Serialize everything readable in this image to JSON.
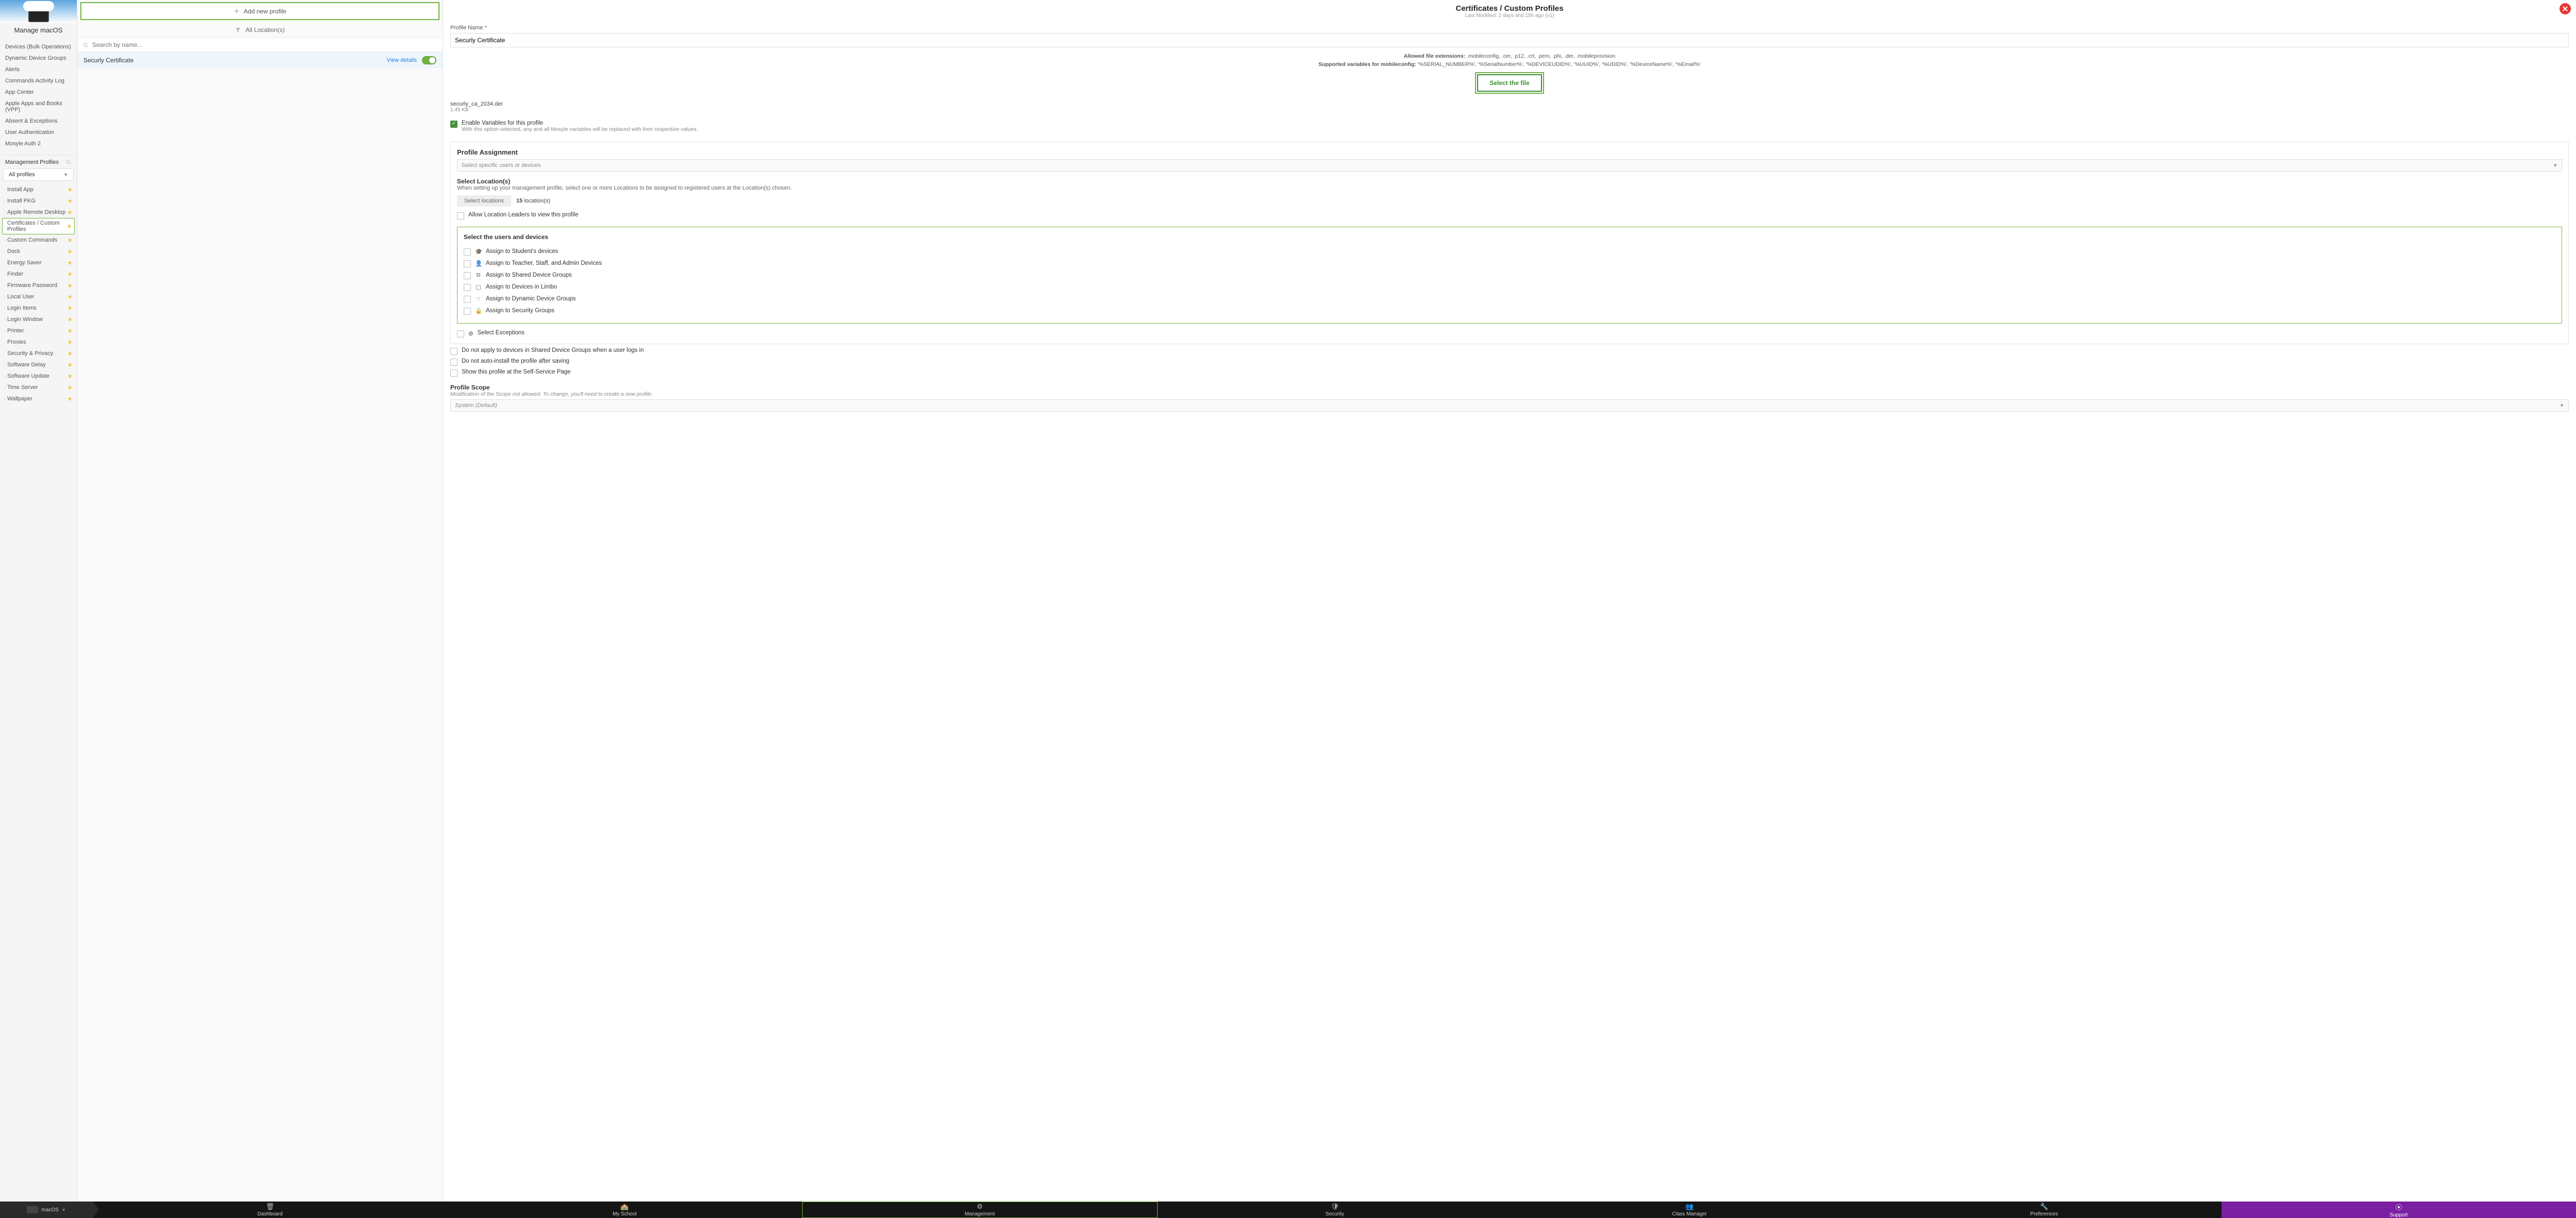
{
  "sidebar": {
    "title": "Manage macOS",
    "nav": [
      "Devices (Bulk Operations)",
      "Dynamic Device Groups",
      "Alerts",
      "Commands Activity Log",
      "App Center",
      "Apple Apps and Books (VPP)",
      "Absent & Exceptions",
      "User Authentication",
      "Mosyle Auth 2"
    ],
    "profiles_header": "Management Profiles",
    "all_profiles": "All profiles",
    "profiles": [
      {
        "label": "Install App",
        "dot": true,
        "star": true
      },
      {
        "label": "Install PKG",
        "dot": true,
        "star": true
      },
      {
        "label": "Apple Remote Desktop",
        "dot": true,
        "star": true
      },
      {
        "label": "Certificates / Custom Profiles",
        "dot": true,
        "star": true,
        "selected": true
      },
      {
        "label": "Custom Commands",
        "dot": true,
        "star": true
      },
      {
        "label": "Dock",
        "dot": true,
        "star": true
      },
      {
        "label": "Energy Saver",
        "dot": false,
        "star": true
      },
      {
        "label": "Finder",
        "dot": true,
        "star": true
      },
      {
        "label": "Firmware Password",
        "dot": true,
        "star": true
      },
      {
        "label": "Local User",
        "dot": true,
        "star": true
      },
      {
        "label": "Login Items",
        "dot": true,
        "star": true
      },
      {
        "label": "Login Window",
        "dot": true,
        "star": true
      },
      {
        "label": "Printer",
        "dot": true,
        "star": true
      },
      {
        "label": "Proxies",
        "dot": true,
        "star": true
      },
      {
        "label": "Security & Privacy",
        "dot": true,
        "star": true
      },
      {
        "label": "Software Delay",
        "dot": true,
        "star": true
      },
      {
        "label": "Software Update",
        "dot": true,
        "star": true
      },
      {
        "label": "Time Server",
        "dot": true,
        "star": true
      },
      {
        "label": "Wallpaper",
        "dot": true,
        "star": true
      }
    ]
  },
  "middle": {
    "add_label": "Add new profile",
    "all_locations": "All Location(s)",
    "search_placeholder": "Search by name...",
    "row_label": "Securly Certificate",
    "view_details": "View details"
  },
  "detail": {
    "title": "Certificates / Custom Profiles",
    "subtitle": "Last Modified: 2 days and 15h ago (v1)",
    "profile_name_label": "Profile Name",
    "profile_name_value": "Securly Certificate",
    "allowed_label": "Allowed file extensions:",
    "allowed_value": ".mobileconfig, .cer, .p12, .crt, .pem, .pfx, .der, .mobileprovision",
    "supported_label": "Supported variables for mobileconfig:",
    "supported_value": "'%SERIAL_NUMBER%', '%SerialNumber%', '%DEVICEUDID%', '%UUID%', '%UDID%', '%DeviceName%', '%Email%'",
    "select_file_btn": "Select the file",
    "file_name": "securly_ca_2034.der",
    "file_size": "1.45 KB",
    "enable_vars_label": "Enable Variables for this profile",
    "enable_vars_sub": "With this option selected, any and all Mosyle variables will be replaced with their respective values.",
    "assignment_title": "Profile Assignment",
    "assignment_placeholder": "Select specific users or devices",
    "select_locations_title": "Select Location(s)",
    "select_locations_desc": "When setting up your management profile, select one or more Locations to be assigned to registered users at the Location(s) chosen.",
    "select_locations_btn": "Select locations",
    "locations_count_num": "15",
    "locations_count_suffix": "location(s)",
    "allow_leaders": "Allow Location Leaders to view this profile",
    "users_box_title": "Select the users and devices",
    "assign_rows": [
      {
        "icon": "🎓",
        "label": "Assign to Student's devices"
      },
      {
        "icon": "👤",
        "label": "Assign to Teacher, Staff, and Admin Devices"
      },
      {
        "icon": "⧉",
        "label": "Assign to Shared Device Groups"
      },
      {
        "icon": "▢",
        "label": "Assign to Devices in Limbo"
      },
      {
        "icon": "∵",
        "label": "Assign to Dynamic Device Groups"
      },
      {
        "icon": "🔒",
        "label": "Assign to Security Groups"
      }
    ],
    "select_exceptions": "Select Exceptions",
    "extra_checks": [
      "Do not apply to devices in Shared Device Groups when a user logs in",
      "Do not auto-install the profile after saving",
      "Show this profile at the Self-Service Page"
    ],
    "scope_title": "Profile Scope",
    "scope_note": "Modification of the Scope not allowed. To change, you'll need to create a new profile.",
    "scope_value": "System (Default)"
  },
  "bottom": {
    "os_label": "macOS",
    "tabs": [
      {
        "icon": "🗑",
        "label": "Dashboard"
      },
      {
        "icon": "🏫",
        "label": "My School"
      },
      {
        "icon": "⚙",
        "label": "Management",
        "active": true
      },
      {
        "icon": "🛡",
        "label": "Security"
      },
      {
        "icon": "👥",
        "label": "Class Manager"
      },
      {
        "icon": "🔧",
        "label": "Preferences"
      },
      {
        "icon": "⦿",
        "label": "Support",
        "support": true
      }
    ]
  }
}
